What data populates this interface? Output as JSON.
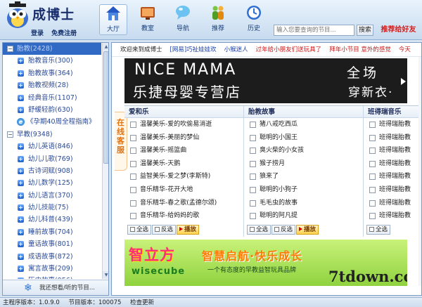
{
  "header": {
    "app_name": "成博士",
    "login": "登录",
    "register": "免费注册",
    "nav": [
      "大厅",
      "教室",
      "导航",
      "推荐",
      "历史"
    ],
    "search_placeholder": "输入您要查询的节目...",
    "search_button": "搜索",
    "recommend": "推荐给好友"
  },
  "sidebar": {
    "items": [
      {
        "label": "胎教(2428)",
        "type": "cat",
        "selected": true
      },
      {
        "label": "胎教音乐(300)",
        "type": "leaf"
      },
      {
        "label": "胎教故事(364)",
        "type": "leaf"
      },
      {
        "label": "胎教视频(28)",
        "type": "leaf"
      },
      {
        "label": "经典音乐(1107)",
        "type": "leaf"
      },
      {
        "label": "舒缓轻韵(630)",
        "type": "leaf"
      },
      {
        "label": "《孕期40周全程指南》",
        "type": "link"
      },
      {
        "label": "早教(9348)",
        "type": "cat"
      },
      {
        "label": "幼儿英语(846)",
        "type": "leaf"
      },
      {
        "label": "幼儿儿歌(769)",
        "type": "leaf"
      },
      {
        "label": "古诗词赋(908)",
        "type": "leaf"
      },
      {
        "label": "幼儿数学(125)",
        "type": "leaf"
      },
      {
        "label": "幼儿语言(370)",
        "type": "leaf"
      },
      {
        "label": "幼儿技能(75)",
        "type": "leaf"
      },
      {
        "label": "幼儿科普(439)",
        "type": "leaf"
      },
      {
        "label": "睡前故事(704)",
        "type": "leaf"
      },
      {
        "label": "童话故事(801)",
        "type": "leaf"
      },
      {
        "label": "成语故事(872)",
        "type": "leaf"
      },
      {
        "label": "寓言故事(209)",
        "type": "leaf"
      },
      {
        "label": "历史故事(956)",
        "type": "leaf"
      }
    ],
    "footer": "我还想看/听的节目..."
  },
  "main": {
    "ticker": [
      {
        "text": "欢迎来到成博士",
        "tone": "w"
      },
      {
        "text": "[网易]巧祉娃娃欢",
        "tone": "b"
      },
      {
        "text": "小猴迷人",
        "tone": "b"
      },
      {
        "text": "过年给小朋友们送玩具了",
        "tone": "r"
      },
      {
        "text": "拜年小节目 意外的感觉",
        "tone": "r"
      },
      {
        "text": "今天",
        "tone": "r"
      }
    ],
    "banner_top": {
      "line1": "NICE MAMA",
      "line2": "乐捷母婴专营店",
      "line3": "全场",
      "line4": "穿新衣·"
    },
    "side_tag": "在线客服",
    "columns": [
      {
        "title": "爱和乐",
        "items": [
          "温馨美乐-爱的吹偷易消逝",
          "温馨美乐-美丽的梦仙",
          "温馨美乐-摇篮曲",
          "温馨美乐-天鹅",
          "益智美乐-爱之梦(李斯特)",
          "音乐精华-花开大地",
          "音乐精华-春之歌(孟德尔颂)",
          "音乐精华-给妈妈的歌"
        ]
      },
      {
        "title": "胎教故事",
        "items": [
          "猪八戒吃西瓜",
          "聪明的小国王",
          "臭火柴的小女孩",
          "猴子捞月",
          "狼来了",
          "聪明的小狗子",
          "毛毛虫的故事",
          "聪明的阿凡提"
        ]
      },
      {
        "title": "班得瑞音乐",
        "items": [
          "班得瑞胎教",
          "班得瑞胎教",
          "班得瑞胎教",
          "班得瑞胎教",
          "班得瑞胎教",
          "班得瑞胎教",
          "班得瑞胎教",
          "班得瑞胎教"
        ]
      }
    ],
    "buttons": {
      "select_all": "全选",
      "invert": "反选",
      "play": "播放"
    },
    "banner_bottom": {
      "logo": "智立方",
      "logo_en": "wisecube",
      "slogan": "智慧启航·快乐成长",
      "tagline": "一个有态度的早教益智玩具品牌",
      "watermark": "7tdown.com"
    }
  },
  "status": {
    "version_label": "主程序版本：",
    "version": "1.0.9.0",
    "node_label": "节目版本：",
    "node": "100075",
    "check": "检查更新"
  }
}
